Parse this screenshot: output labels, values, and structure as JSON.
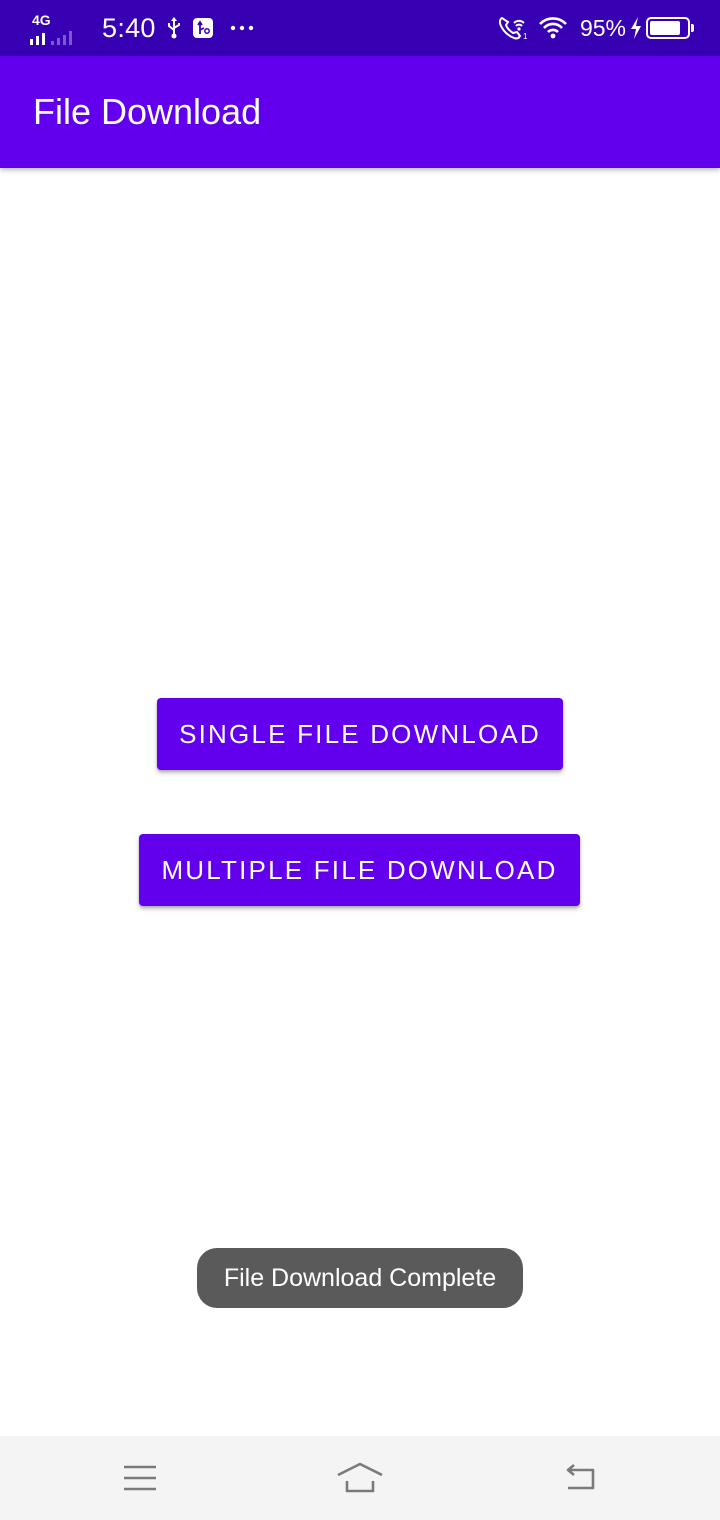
{
  "status_bar": {
    "network_type": "4G",
    "time": "5:40",
    "battery_percent": "95%",
    "battery_level": 0.95,
    "icons": [
      "signal-icon",
      "usb-icon",
      "usb-debug-icon",
      "more-dots-icon",
      "wifi-calling-icon",
      "wifi-icon",
      "charging-icon",
      "battery-icon"
    ]
  },
  "app_bar": {
    "title": "File Download",
    "color": "#6200ee"
  },
  "main": {
    "single_button_label": "Single File Download",
    "multiple_button_label": "Multiple File Download",
    "accent": "#6200ee"
  },
  "toast": {
    "message": "File Download Complete"
  },
  "nav_bar": {
    "icons": [
      "menu-icon",
      "home-icon",
      "back-icon"
    ]
  }
}
